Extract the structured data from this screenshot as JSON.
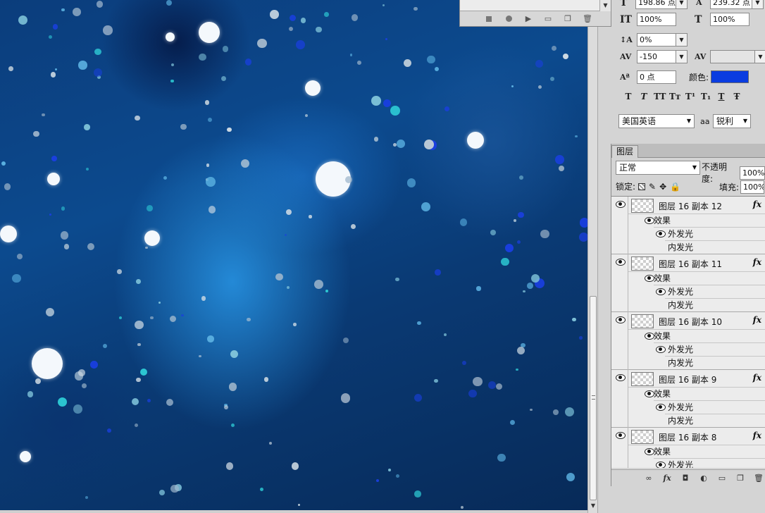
{
  "character": {
    "font_size": "198.86 点",
    "leading": "239.32 点",
    "vertical_scale": "100%",
    "horizontal_scale": "100%",
    "kerning": "0%",
    "tracking": "-150",
    "baseline_shift": "0 点",
    "color_label": "颜色:",
    "color_hex": "#0a3ce0",
    "language": "美国英语",
    "antialias_icon": "aa",
    "antialias": "锐利",
    "style_buttons": [
      "T",
      "T",
      "TT",
      "Tт",
      "T¹",
      "T₁",
      "T",
      "Ŧ"
    ]
  },
  "layers": {
    "tab_label": "图层",
    "blend_mode": "正常",
    "opacity_label": "不透明度:",
    "opacity": "100%",
    "lock_label": "锁定:",
    "fill_label": "填充:",
    "fill": "100%",
    "items": [
      {
        "name": "图层 16 副本 12",
        "effects": "效果",
        "outer_glow": "外发光",
        "inner_glow": "内发光"
      },
      {
        "name": "图层 16 副本 11",
        "effects": "效果",
        "outer_glow": "外发光",
        "inner_glow": "内发光"
      },
      {
        "name": "图层 16 副本 10",
        "effects": "效果",
        "outer_glow": "外发光",
        "inner_glow": "内发光"
      },
      {
        "name": "图层 16 副本 9",
        "effects": "效果",
        "outer_glow": "外发光",
        "inner_glow": "内发光"
      },
      {
        "name": "图层 16 副本 8",
        "effects": "效果",
        "outer_glow": "外发光"
      }
    ]
  }
}
